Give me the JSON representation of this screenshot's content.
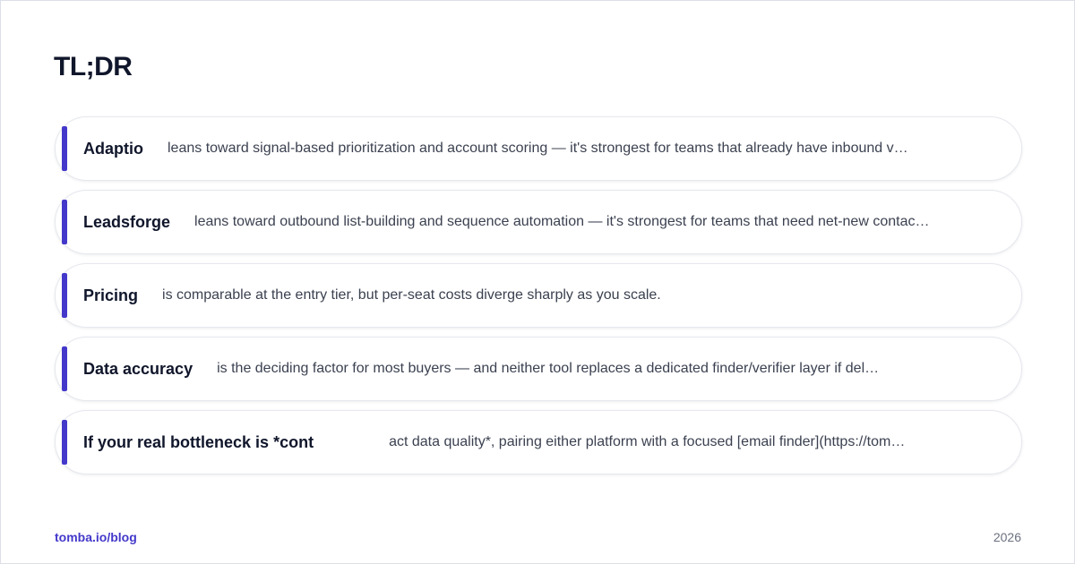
{
  "page": {
    "title": "TL;DR"
  },
  "items": [
    {
      "label": "Adaptio",
      "text": "leans toward signal-based prioritization and account scoring — it's strongest for teams that already have inbound v…"
    },
    {
      "label": "Leadsforge",
      "text": "leans toward outbound list-building and sequence automation — it's strongest for teams that need net-new contac…"
    },
    {
      "label": "Pricing",
      "text": "is comparable at the entry tier, but per-seat costs diverge sharply as you scale."
    },
    {
      "label": "Data accuracy",
      "text": "is the deciding factor for most buyers — and neither tool replaces a dedicated finder/verifier layer if del…"
    },
    {
      "label": "If your real bottleneck is *cont",
      "text": "act data quality*, pairing either platform with a focused [email finder](https://tom…"
    }
  ],
  "footer": {
    "link": "tomba.io/blog",
    "year": "2026"
  },
  "colors": {
    "accent": "#4338ca",
    "title": "#10162b",
    "body_text": "#3b4150",
    "year": "#6b7180",
    "card_border": "#e6e8ee"
  }
}
